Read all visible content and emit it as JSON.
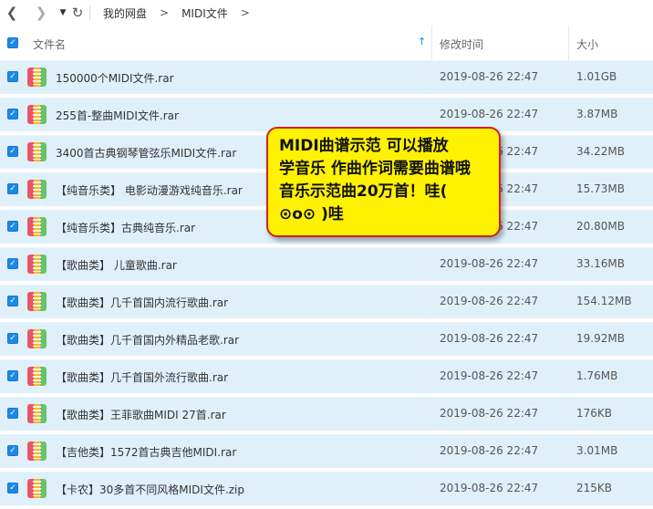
{
  "nav": {
    "back_icon": "back-arrow",
    "forward_icon": "forward-arrow",
    "dropdown_icon": "caret-down",
    "refresh_icon": "refresh",
    "back": "❮",
    "forward": "❯",
    "dropdown": "▼",
    "refresh": "↻",
    "breadcrumb": [
      "我的网盘",
      "MIDI文件"
    ],
    "sep": ">"
  },
  "header": {
    "check": "✓",
    "name": "文件名",
    "sort_icon": "↑",
    "time": "修改时间",
    "size": "大小"
  },
  "files": [
    {
      "name": "150000个MIDI文件.rar",
      "time": "2019-08-26 22:47",
      "size": "1.01GB"
    },
    {
      "name": "255首-整曲MIDI文件.rar",
      "time": "2019-08-26 22:47",
      "size": "3.87MB"
    },
    {
      "name": "3400首古典钢琴管弦乐MIDI文件.rar",
      "time": "2019-08-26 22:47",
      "size": "34.22MB"
    },
    {
      "name": "【纯音乐类】 电影动漫游戏纯音乐.rar",
      "time": "2019-08-26 22:47",
      "size": "15.73MB"
    },
    {
      "name": "【纯音乐类】古典纯音乐.rar",
      "time": "2019-08-26 22:47",
      "size": "20.80MB"
    },
    {
      "name": "【歌曲类】 儿童歌曲.rar",
      "time": "2019-08-26 22:47",
      "size": "33.16MB"
    },
    {
      "name": "【歌曲类】几千首国内流行歌曲.rar",
      "time": "2019-08-26 22:47",
      "size": "154.12MB"
    },
    {
      "name": "【歌曲类】几千首国内外精品老歌.rar",
      "time": "2019-08-26 22:47",
      "size": "19.92MB"
    },
    {
      "name": "【歌曲类】几千首国外流行歌曲.rar",
      "time": "2019-08-26 22:47",
      "size": "1.76MB"
    },
    {
      "name": "【歌曲类】王菲歌曲MIDI 27首.rar",
      "time": "2019-08-26 22:47",
      "size": "176KB"
    },
    {
      "name": "【吉他类】1572首古典吉他MIDI.rar",
      "time": "2019-08-26 22:47",
      "size": "3.01MB"
    },
    {
      "name": "【卡农】30多首不同风格MIDI文件.zip",
      "time": "2019-08-26 22:47",
      "size": "215KB"
    }
  ],
  "callout": {
    "lines": [
      "MIDI曲谱示范 可以播放",
      "学音乐 作曲作词需要曲谱哦",
      "音乐示范曲20万首！哇(",
      "⊙o⊙ )哇"
    ]
  },
  "colors": {
    "accent": "#1e88e5",
    "row_selected": "#dff0fb",
    "callout_bg": "#fff200",
    "callout_border": "#d0212b"
  }
}
